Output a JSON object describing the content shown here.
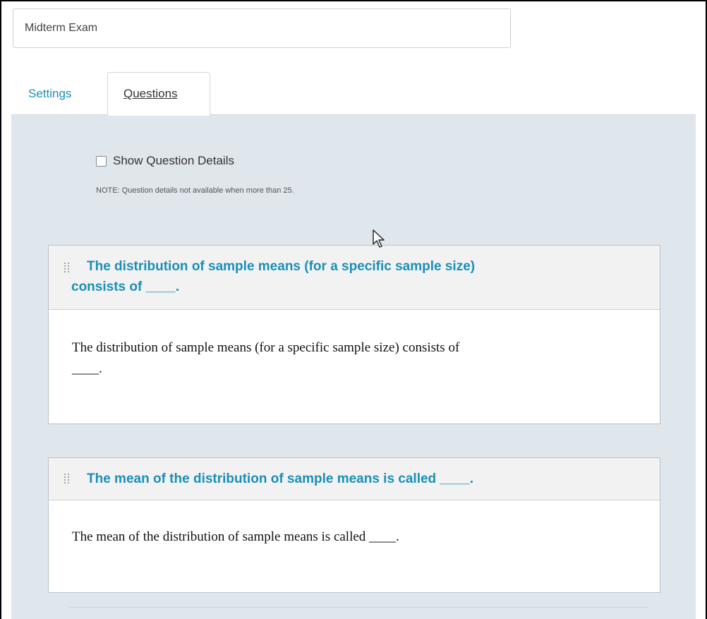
{
  "exam": {
    "title": "Midterm Exam"
  },
  "tabs": {
    "settings": "Settings",
    "questions": "Questions"
  },
  "options": {
    "show_details_label": "Show Question Details",
    "show_details_checked": false,
    "note": "NOTE: Question details not available when more than 25."
  },
  "questions": [
    {
      "title": "The distribution of sample means (for a specific sample size) consists of ____.",
      "title_line1": "The distribution of sample means (for a specific sample size)",
      "title_line2": "consists of ____.",
      "body_line1": "The distribution of sample means (for a specific sample size) consists of",
      "body_line2": "____."
    },
    {
      "title": "The mean of the distribution of sample means is called ____.",
      "body": "The mean of the distribution of sample means is called ____."
    }
  ],
  "colors": {
    "accent": "#1a8fb8",
    "panel": "#dfe6ec",
    "card_header": "#f2f2f2"
  },
  "icons": {
    "drag": "drag-handle-icon",
    "cursor": "mouse-pointer-icon"
  }
}
